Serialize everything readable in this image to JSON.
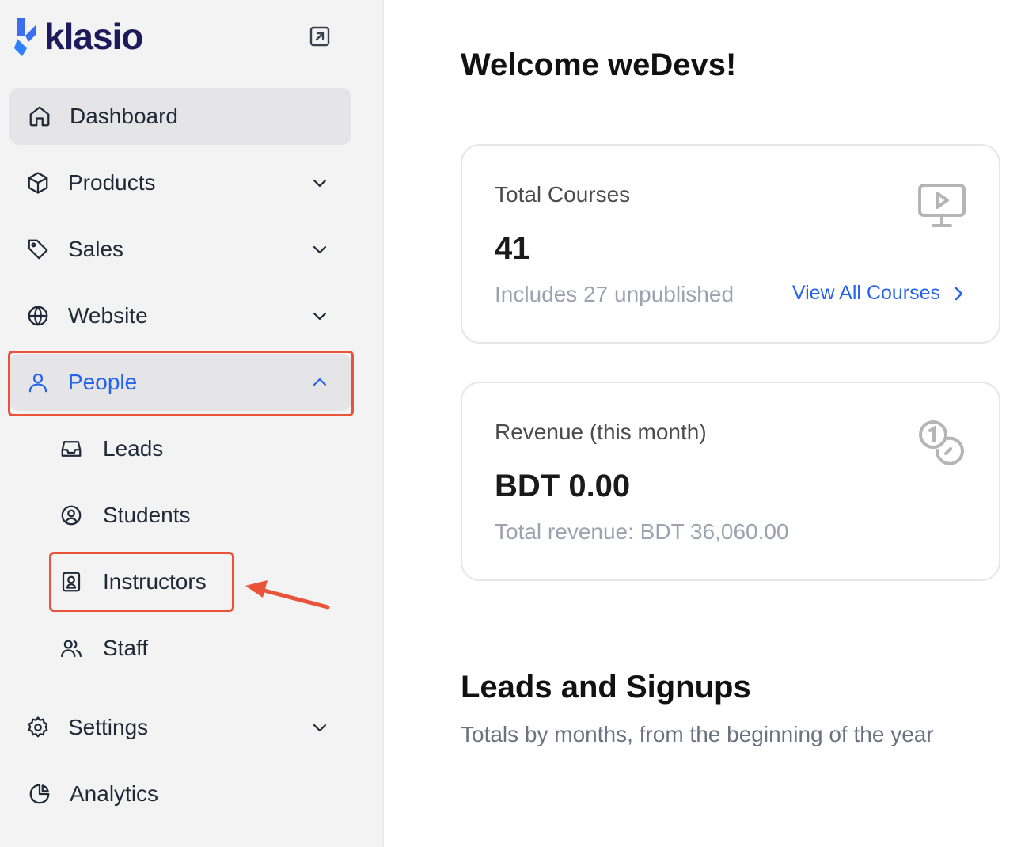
{
  "brand": {
    "name": "klasio",
    "accent": "#2563eb",
    "logo_color": "#1e1b5c"
  },
  "sidebar": {
    "collapse_icon": "arrow-up-right-box-icon",
    "items": [
      {
        "label": "Dashboard",
        "icon": "home-icon",
        "active": true
      },
      {
        "label": "Products",
        "icon": "cube-icon",
        "expandable": true
      },
      {
        "label": "Sales",
        "icon": "tag-icon",
        "expandable": true
      },
      {
        "label": "Website",
        "icon": "globe-icon",
        "expandable": true
      },
      {
        "label": "People",
        "icon": "user-icon",
        "expandable": true,
        "expanded": true,
        "children": [
          {
            "label": "Leads",
            "icon": "inbox-icon"
          },
          {
            "label": "Students",
            "icon": "user-circle-icon"
          },
          {
            "label": "Instructors",
            "icon": "id-badge-icon"
          },
          {
            "label": "Staff",
            "icon": "users-icon"
          }
        ]
      },
      {
        "label": "Settings",
        "icon": "gear-icon",
        "expandable": true
      },
      {
        "label": "Analytics",
        "icon": "pie-chart-icon"
      }
    ]
  },
  "main": {
    "welcome": "Welcome weDevs!",
    "cards": [
      {
        "title": "Total Courses",
        "value": "41",
        "sub": "Includes 27 unpublished",
        "link": "View All Courses",
        "icon": "video-monitor-icon"
      },
      {
        "title": "Revenue (this month)",
        "value": "BDT 0.00",
        "sub": "Total revenue: BDT 36,060.00",
        "icon": "coins-icon"
      }
    ],
    "leads_title": "Leads and Signups",
    "leads_sub": "Totals by months, from the beginning of the year"
  },
  "annotation_color": "#e8533a"
}
